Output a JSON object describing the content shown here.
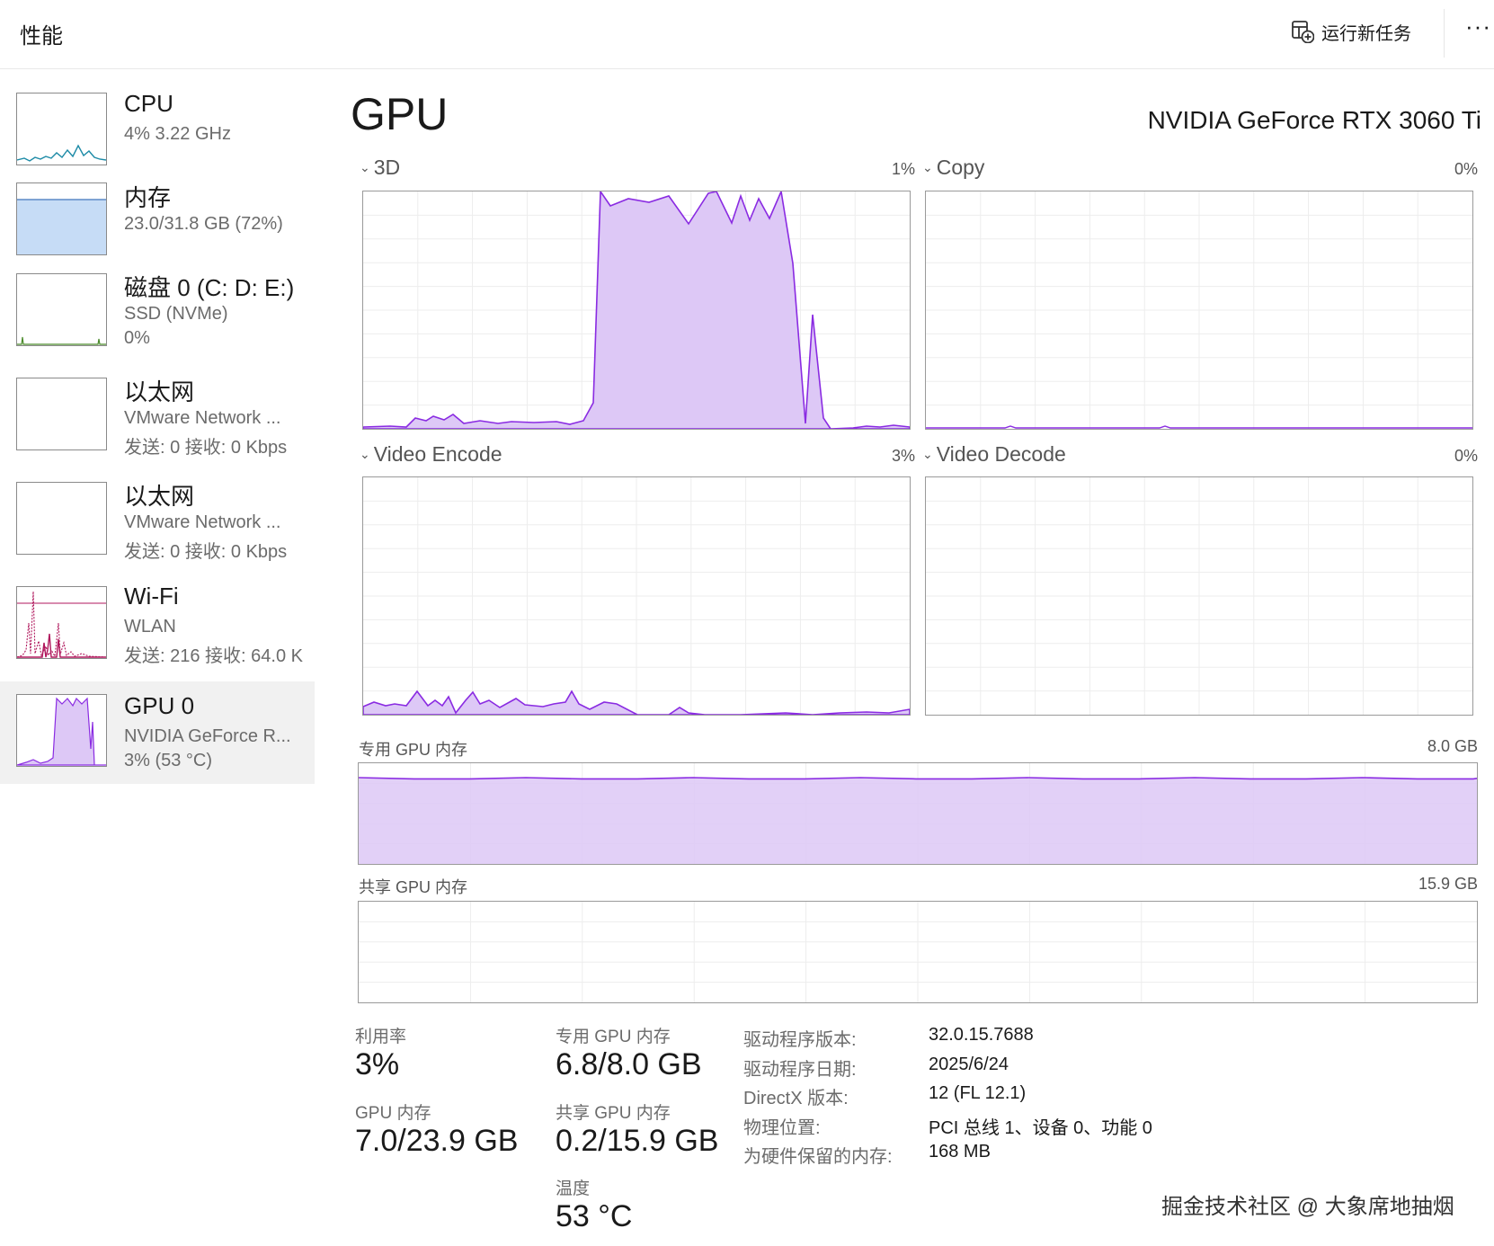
{
  "header": {
    "title": "性能",
    "run_task_label": "运行新任务",
    "more_label": "···"
  },
  "sidebar": {
    "items": [
      {
        "name": "CPU",
        "line1": "4%  3.22 GHz",
        "line2": ""
      },
      {
        "name": "内存",
        "line1": "23.0/31.8 GB (72%)",
        "line2": ""
      },
      {
        "name": "磁盘 0 (C: D: E:)",
        "line1": "SSD (NVMe)",
        "line2": "0%"
      },
      {
        "name": "以太网",
        "line1": "VMware Network ...",
        "line2": "发送: 0 接收: 0 Kbps"
      },
      {
        "name": "以太网",
        "line1": "VMware Network ...",
        "line2": "发送: 0 接收: 0 Kbps"
      },
      {
        "name": "Wi-Fi",
        "line1": "WLAN",
        "line2": "发送: 216 接收: 64.0 K"
      },
      {
        "name": "GPU 0",
        "line1": "NVIDIA GeForce R...",
        "line2": "3% (53 °C)"
      }
    ]
  },
  "main": {
    "title": "GPU",
    "device": "NVIDIA GeForce RTX 3060 Ti",
    "engines": [
      {
        "name": "3D",
        "percent": "1%"
      },
      {
        "name": "Copy",
        "percent": "0%"
      },
      {
        "name": "Video Encode",
        "percent": "3%"
      },
      {
        "name": "Video Decode",
        "percent": "0%"
      }
    ],
    "dedicated_mem": {
      "label": "专用 GPU 内存",
      "max": "8.0 GB",
      "fill": 0.85
    },
    "shared_mem": {
      "label": "共享 GPU 内存",
      "max": "15.9 GB",
      "fill": 0.0
    }
  },
  "stats": {
    "utilization": {
      "label": "利用率",
      "value": "3%"
    },
    "dedicated": {
      "label": "专用 GPU 内存",
      "value": "6.8/8.0 GB"
    },
    "gpu_memory": {
      "label": "GPU 内存",
      "value": "7.0/23.9 GB"
    },
    "shared": {
      "label": "共享 GPU 内存",
      "value": "0.2/15.9 GB"
    },
    "temperature": {
      "label": "温度",
      "value": "53 °C"
    }
  },
  "info": [
    {
      "key": "驱动程序版本:",
      "value": "32.0.15.7688"
    },
    {
      "key": "驱动程序日期:",
      "value": "2025/6/24"
    },
    {
      "key": "DirectX 版本:",
      "value": "12 (FL 12.1)"
    },
    {
      "key": "物理位置:",
      "value": "PCI 总线 1、设备 0、功能 0"
    },
    {
      "key": "为硬件保留的内存:",
      "value": "168 MB"
    }
  ],
  "watermark": "掘金技术社区 @ 大象席地抽烟",
  "colors": {
    "gpu_line": "#8a2be2",
    "gpu_fill": "#ddc8f6",
    "grid": "#ededed",
    "mem_fill": "#c6dcf6",
    "wifi": "#b0175c",
    "cpu": "#1c8aa6"
  }
}
